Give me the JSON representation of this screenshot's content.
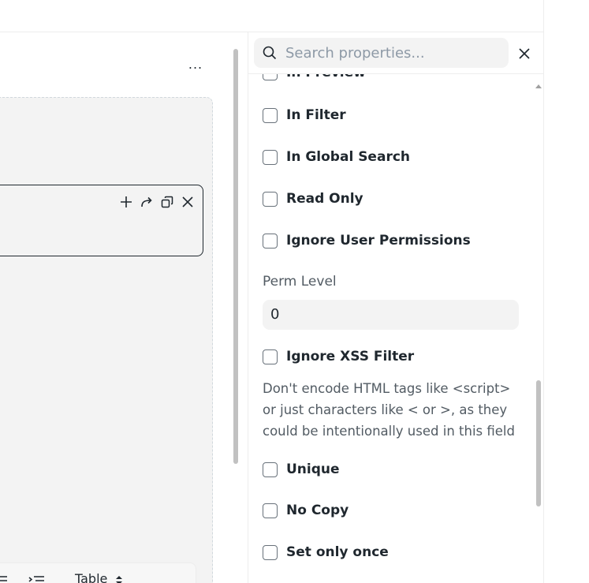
{
  "builder": {
    "more_label": "...",
    "toolbar_table_label": "Table"
  },
  "properties": {
    "search": {
      "placeholder": "Search properties...",
      "value": ""
    },
    "checks": [
      {
        "label": "In Preview",
        "checked": false
      },
      {
        "label": "In Filter",
        "checked": false
      },
      {
        "label": "In Global Search",
        "checked": false
      },
      {
        "label": "Read Only",
        "checked": false
      },
      {
        "label": "Ignore User Permissions",
        "checked": false
      }
    ],
    "perm_level": {
      "label": "Perm Level",
      "value": "0"
    },
    "ignore_xss": {
      "label": "Ignore XSS Filter",
      "checked": false
    },
    "ignore_xss_description": "Don't encode HTML tags like <script> or just characters like < or >, as they could be intentionally used in this field",
    "checks_after": [
      {
        "label": "Unique",
        "checked": false
      },
      {
        "label": "No Copy",
        "checked": false
      },
      {
        "label": "Set only once",
        "checked": false
      }
    ]
  },
  "icons": {
    "search": "search-icon",
    "close": "close-icon",
    "add": "plus-icon",
    "move": "redo-arrow-icon",
    "duplicate": "duplicate-icon",
    "remove": "close-icon"
  }
}
